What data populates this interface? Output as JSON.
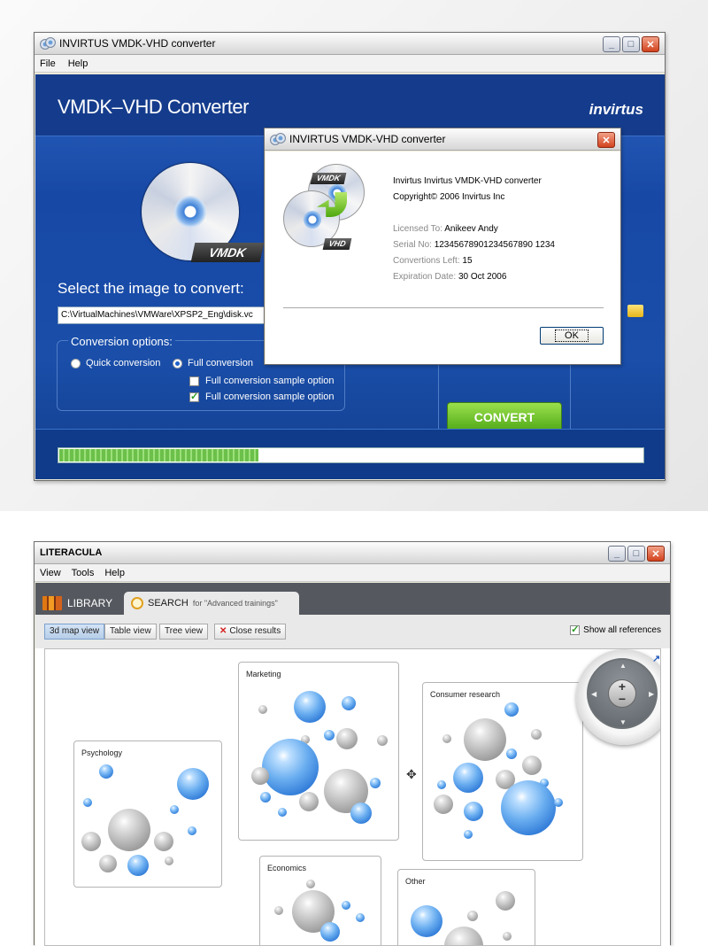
{
  "vmdk_window": {
    "title": "INVIRTUS VMDK-VHD converter",
    "menu": [
      "File",
      "Help"
    ],
    "header_title": "VMDK–VHD Converter",
    "brand": "invirtus",
    "vmdk_tag": "VMDK",
    "select_label": "Select the image to convert:",
    "path_value": "C:\\VirtualMachines\\VMWare\\XPSP2_Eng\\disk.vc",
    "conversion_options": {
      "title": "Conversion options:",
      "quick": "Quick conversion",
      "full": "Full conversion",
      "selected": "full",
      "sample1": {
        "label": "Full conversion sample option",
        "checked": false
      },
      "sample2": {
        "label": "Full conversion sample option",
        "checked": true
      }
    },
    "convert_label": "CONVERT",
    "progress": 0.34
  },
  "about_dialog": {
    "title": "INVIRTUS VMDK-VHD converter",
    "vmdk_tag": "VMDK",
    "vhd_tag": "VHD",
    "product": "Invirtus Invirtus VMDK-VHD converter",
    "copyright": "Copyright© 2006 Invirtus Inc",
    "licensed_label": "Licensed To:",
    "licensed_value": "Anikeev Andy",
    "serial_label": "Serial No:",
    "serial_value": "12345678901234567890 1234",
    "left_label": "Convertions Left:",
    "left_value": "15",
    "exp_label": "Expiration Date:",
    "exp_value": "30 Oct 2006",
    "ok_label": "OK"
  },
  "literacula_window": {
    "title": "LITERACULA",
    "menu": [
      "View",
      "Tools",
      "Help"
    ],
    "tab_library": "LIBRARY",
    "tab_search": "SEARCH",
    "tab_search_sub": "for \"Advanced trainings\"",
    "views": [
      "3d map view",
      "Table view",
      "Tree view"
    ],
    "active_view": "3d map view",
    "close_results": "Close results",
    "show_all": "Show all references",
    "show_all_checked": true,
    "groups": [
      "Psychology",
      "Marketing",
      "Consumer research",
      "Economics",
      "Other"
    ]
  },
  "icons": {
    "app": "disc-icon",
    "folder": "folder-icon",
    "library": "books-icon",
    "search": "magnifier-icon",
    "move": "move-icon",
    "navigator": "zoom-navigator-icon"
  },
  "colors": {
    "accent_blue": "#1a4ea9",
    "convert_green": "#5fb41e",
    "progress_green": "#6cc04a"
  }
}
